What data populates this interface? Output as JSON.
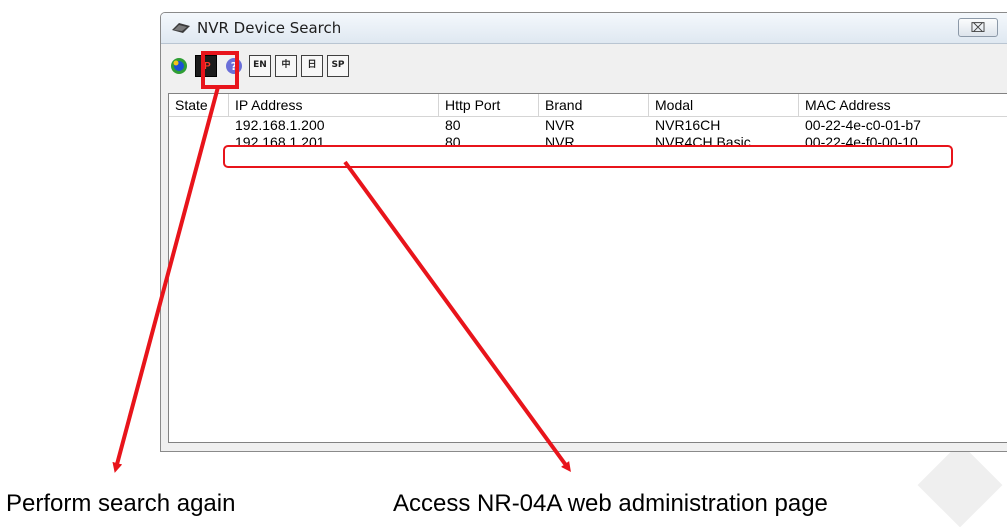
{
  "window": {
    "title": "NVR Device Search",
    "close_glyph": "⌧"
  },
  "toolbar": {
    "buttons": [
      {
        "name": "search-icon",
        "label": ""
      },
      {
        "name": "ip-icon",
        "label": "IP"
      },
      {
        "name": "help-icon",
        "label": ""
      },
      {
        "name": "lang-en-button",
        "label": "EN"
      },
      {
        "name": "lang-zh-button",
        "label": "中"
      },
      {
        "name": "lang-jp-button",
        "label": "日"
      },
      {
        "name": "lang-sp-button",
        "label": "SP"
      }
    ]
  },
  "table": {
    "columns": [
      "State",
      "IP Address",
      "Http Port",
      "Brand",
      "Modal",
      "MAC Address"
    ],
    "rows": [
      [
        "",
        "192.168.1.200",
        "80",
        "NVR",
        "NVR16CH",
        "00-22-4e-c0-01-b7"
      ],
      [
        "",
        "192.168.1.201",
        "80",
        "NVR",
        "NVR4CH Basic",
        "00-22-4e-f0-00-10"
      ]
    ]
  },
  "annotations": {
    "left_caption": "Perform search again",
    "right_caption": "Access NR-04A web administration page",
    "color": "#e8141b"
  }
}
